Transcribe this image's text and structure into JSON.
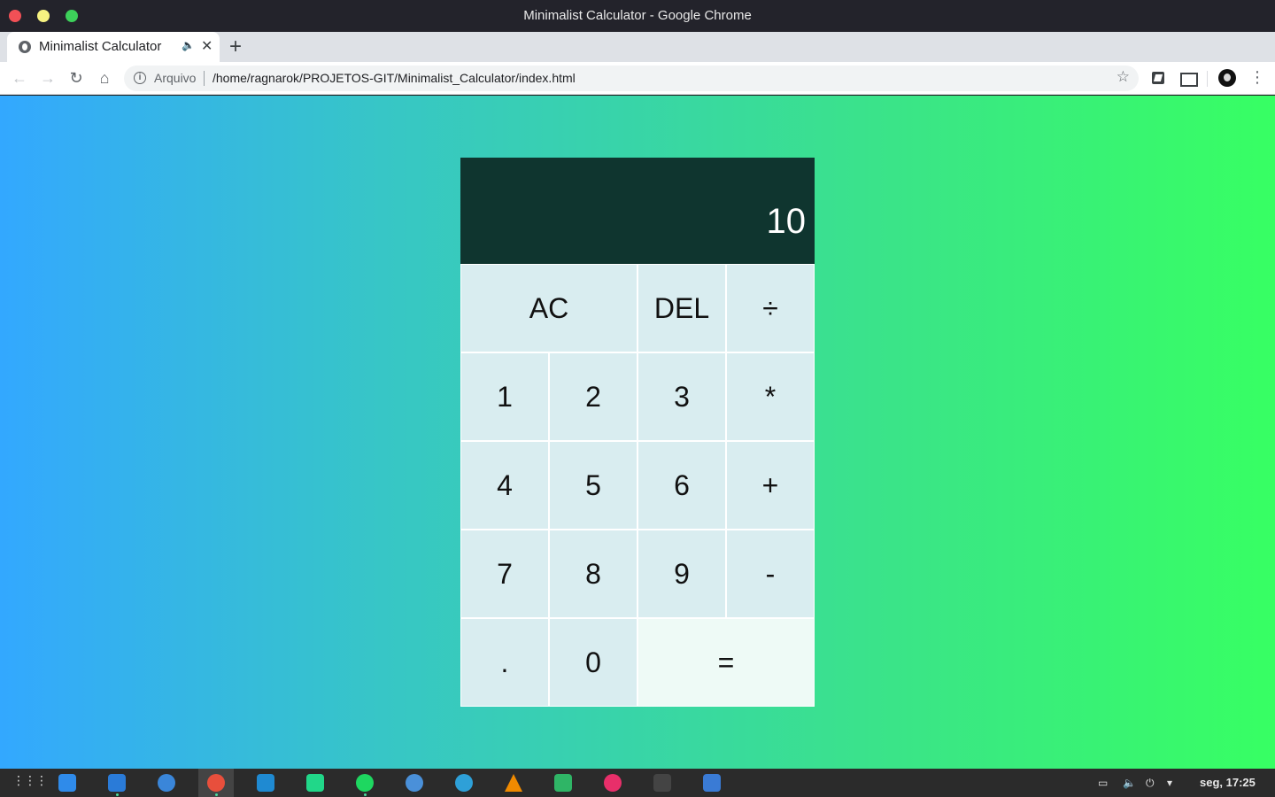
{
  "window": {
    "title": "Minimalist Calculator - Google Chrome"
  },
  "tab": {
    "title": "Minimalist Calculator",
    "audio_icon": "🔈",
    "close_icon": "✕",
    "new_tab_icon": "+"
  },
  "toolbar": {
    "back_icon": "←",
    "forward_icon": "→",
    "reload_icon": "↻",
    "home_icon": "⌂",
    "info_icon": "i",
    "scheme_label": "Arquivo",
    "url": "/home/ragnarok/PROJETOS-GIT/Minimalist_Calculator/index.html",
    "star_icon": "☆",
    "menu_icon": "⋮"
  },
  "calculator": {
    "display": "10",
    "keys": {
      "ac": "AC",
      "del": "DEL",
      "divide": "÷",
      "one": "1",
      "two": "2",
      "three": "3",
      "multiply": "*",
      "four": "4",
      "five": "5",
      "six": "6",
      "plus": "+",
      "seven": "7",
      "eight": "8",
      "nine": "9",
      "minus": "-",
      "dot": ".",
      "zero": "0",
      "equals": "="
    }
  },
  "taskbar": {
    "apps": [
      {
        "name": "app-grid-icon",
        "color": "#dddddd"
      },
      {
        "name": "screenshot-icon",
        "color": "#2f8bea"
      },
      {
        "name": "files-icon",
        "color": "#2a7bd8"
      },
      {
        "name": "settings-icon",
        "color": "#3a86d9"
      },
      {
        "name": "chrome-icon",
        "color": "#e84f3c"
      },
      {
        "name": "vscode-icon",
        "color": "#1f8ad2"
      },
      {
        "name": "pycharm-icon",
        "color": "#21d789"
      },
      {
        "name": "spotify-icon",
        "color": "#1ed760"
      },
      {
        "name": "browser-icon",
        "color": "#4a90d9"
      },
      {
        "name": "downloader-icon",
        "color": "#2ea0d8"
      },
      {
        "name": "vlc-icon",
        "color": "#f08a00"
      },
      {
        "name": "cloud-icon",
        "color": "#2fb566"
      },
      {
        "name": "flickr-icon",
        "color": "#e82f6a"
      },
      {
        "name": "terminal-icon",
        "color": "#444444"
      },
      {
        "name": "screen-recorder-icon",
        "color": "#3a7bd5"
      }
    ],
    "clock": "seg, 17:25"
  }
}
